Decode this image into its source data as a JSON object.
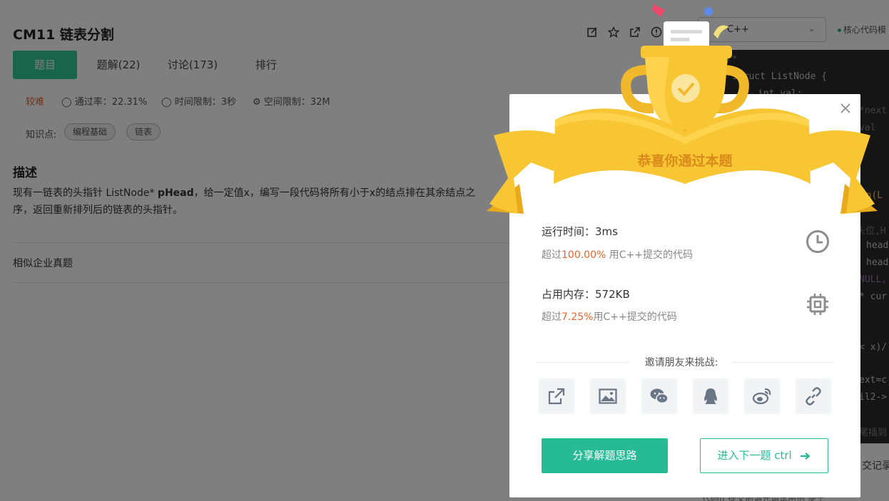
{
  "problem": {
    "title": "CM11  链表分割",
    "tabs": [
      "题目",
      "题解(22)",
      "讨论(173)",
      "排行"
    ],
    "difficulty": "较难",
    "pass_rate": "通过率：22.31%",
    "time_limit": "时间限制：3秒",
    "memory_limit": "空间限制：32M",
    "knowledge_label": "知识点:",
    "tags": [
      "编程基础",
      "链表"
    ],
    "desc_heading": "描述",
    "desc_prefix": "现有一链表的头指针 ListNode* ",
    "desc_bold": "pHead",
    "desc_suffix": "，给一定值x，编写一段代码将所有小于x的结点排在其余结点之",
    "desc_line2": "序，返回重新排列后的链表的头指针。",
    "similar": "相似企业真题"
  },
  "editor": {
    "language": "C++",
    "core_mode": "核心代码模",
    "code_lines": [
      "/*",
      "struct ListNode {",
      "int val;",
      "*next",
      "val",
      "ion(L",
      "头位,H",
      "head",
      "head",
      "NULL,",
      "* cur",
      "< x)/",
      "ext=c",
      "il2->",
      "尾插到"
    ],
    "submit_records": "交记录",
    "footer": "代码ff    提交前请先调试用例   便于"
  },
  "modal": {
    "banner": "恭喜你通过本题",
    "runtime_label": "运行时间：3ms",
    "runtime_prefix": "超过",
    "runtime_pct": "100.00%",
    "runtime_suffix": " 用C++提交的代码",
    "memory_label": "占用内存：572KB",
    "memory_prefix": "超过",
    "memory_pct": "7.25%",
    "memory_suffix": "用C++提交的代码",
    "invite": "邀请朋友来挑战:",
    "share_button": "分享解题思路",
    "next_button": "进入下一题 ctrl"
  },
  "colors": {
    "accent": "#26bb95",
    "highlight": "#e8632a",
    "gold": "#f5c33b"
  }
}
